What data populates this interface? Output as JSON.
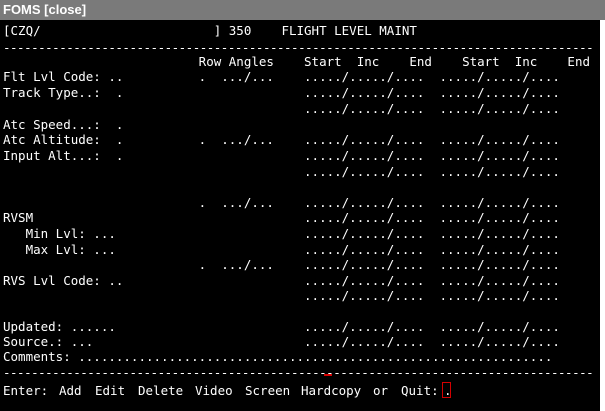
{
  "window": {
    "title": "FOMS [close]"
  },
  "header": {
    "text": "[CZQ/                       ] 350    FLIGHT LEVEL MAINT"
  },
  "divider": "------------------------------------------------------------------------------------",
  "columns": {
    "text": "                          Row Angles    Start  Inc    End    Start  Inc    End"
  },
  "rows": [
    "Flt Lvl Code: ..          .  .../...    ...../...../....  ...../...../....",
    "Track Type..:  .                        ...../...../....  ...../...../....",
    "                                        ...../...../....  ...../...../....",
    "Atc Speed...:  .",
    "Atc Altitude:  .          .  .../...    ...../...../....  ...../...../....",
    "Input Alt...:  .                        ...../...../....  ...../...../....",
    "                                        ...../...../....  ...../...../....",
    "",
    "                          .  .../...    ...../...../....  ...../...../....",
    "RVSM                                    ...../...../....  ...../...../....",
    "   Min Lvl: ...                         ...../...../....  ...../...../....",
    "   Max Lvl: ...                         ...../...../....  ...../...../....",
    "                          .  .../...    ...../...../....  ...../...../....",
    "RVS Lvl Code: ..                        ...../...../....  ...../...../....",
    "                                        ...../...../....  ...../...../....",
    "",
    "Updated: ......                         ...../...../....  ...../...../....",
    "Source.: ...                            ...../...../....  ...../...../....",
    "Comments: ..............................................................."
  ],
  "footer_divider": "------------------------------------------------------------------------------------",
  "command_line": {
    "prompt": "Enter:",
    "options": [
      "Add",
      "Edit",
      "Delete",
      "Video",
      "Screen",
      "Hardcopy"
    ],
    "or_label": "or",
    "quit": "Quit:",
    "input_value": "."
  },
  "colors": {
    "background": "#000000",
    "text": "#ffffff",
    "titlebar": "#7a7a7a",
    "cursor": "#d40000"
  }
}
